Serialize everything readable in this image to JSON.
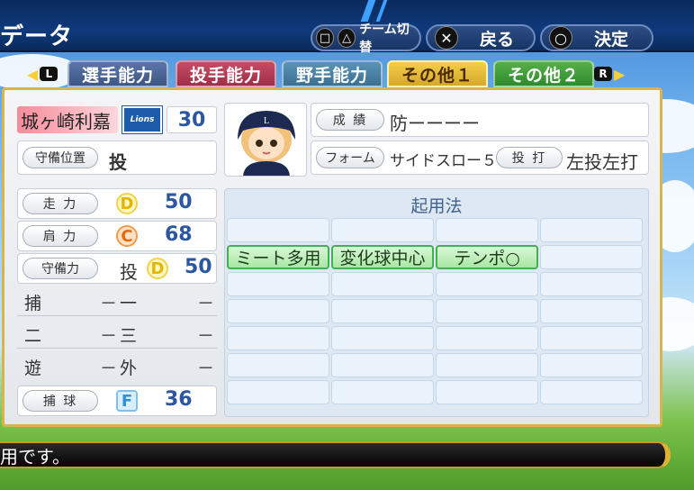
{
  "header": {
    "title": "データ",
    "team_switch": {
      "symbols": [
        "□",
        "△"
      ],
      "label": "チーム切替"
    },
    "back": {
      "symbol": "✕",
      "label": "戻る"
    },
    "confirm": {
      "symbol": "○",
      "label": "決定"
    }
  },
  "tabs": {
    "left_key": "L",
    "right_key": "R",
    "items": [
      {
        "label": "選手能力"
      },
      {
        "label": "投手能力"
      },
      {
        "label": "野手能力"
      },
      {
        "label": "その他１",
        "active": true
      },
      {
        "label": "その他２"
      }
    ]
  },
  "player": {
    "name": "城ヶ崎利嘉",
    "team_logo_text": "Lions",
    "number": "30",
    "position_label": "守備位置",
    "position": "投",
    "record_label": "成 績",
    "record_value": "防ーーーー",
    "form_label": "フォーム",
    "form_value": "サイドスロー５４",
    "bats_throws_label": "投 打",
    "bats_throws_value": "左投左打"
  },
  "abilities": {
    "speed": {
      "label": "走 力",
      "grade": "D",
      "value": "50"
    },
    "arm": {
      "label": "肩 力",
      "grade": "C",
      "value": "68"
    },
    "fielding": {
      "label": "守備力",
      "position": "投",
      "grade": "D",
      "value": "50"
    },
    "catching": {
      "label": "捕 球",
      "grade": "F",
      "value": "36"
    }
  },
  "positions": {
    "catcher": "捕",
    "catcher_val": "－",
    "first": "一",
    "first_val": "－",
    "second": "二",
    "second_val": "－",
    "third": "三",
    "third_val": "－",
    "short": "遊",
    "short_val": "－",
    "outfield": "外",
    "outfield_val": "－"
  },
  "usage": {
    "title": "起用法",
    "tags": [
      "ミート多用",
      "変化球中心",
      "テンポ○"
    ]
  },
  "message": "用です。"
}
